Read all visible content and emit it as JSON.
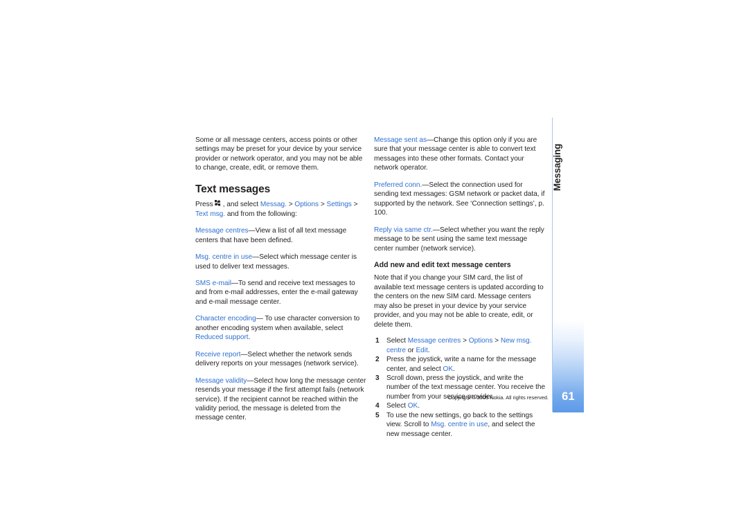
{
  "page": {
    "number": "61",
    "tab_label": "Messaging",
    "copyright": "Copyright © 2005 Nokia. All rights reserved.",
    "accent_blue": "#2f6fd0",
    "tab_gradient_end": "#5d9ae8",
    "divider_color": "#a9c8ea"
  },
  "left_column": {
    "intro_paragraph": "Some or all message centers, access points or other settings may be preset for your device by your service provider or network operator, and you may not be able to change, create, edit, or remove them.",
    "section_title": "Text messages",
    "press_line": {
      "prefix": "Press",
      "icon": "menu-key-icon",
      "middle": ", and select",
      "link1": "Messag.",
      "sep1": ">",
      "link2": "Options",
      "sep2": ">",
      "link3": "Settings",
      "sep3": ">",
      "link4": "Text msg.",
      "suffix": "and from the following:"
    },
    "settings": [
      {
        "term": "Message centres",
        "body": "—View a list of all text message centers that have been defined."
      },
      {
        "term": "Msg. centre in use",
        "body": "—Select which message center is used to deliver text messages."
      },
      {
        "term": "SMS e-mail",
        "body": "—To send and receive text messages to and from e-mail addresses, enter the e-mail gateway and e-mail message center."
      },
      {
        "term": "Character encoding",
        "body": "— To use character conversion to another encoding system when available, select ",
        "term2": "Reduced support",
        "body2": "."
      },
      {
        "term": "Receive report",
        "body": "—Select whether the network sends delivery reports on your messages (network service)."
      },
      {
        "term": "Message validity",
        "body": "—Select how long the message center resends your message if the first attempt fails (network service). If the recipient cannot be reached within the validity period, the message is deleted from the message center."
      }
    ]
  },
  "right_column": {
    "settings": [
      {
        "term": "Message sent as",
        "body": "—Change this option only if you are sure that your message center is able to convert text messages into these other formats. Contact your network operator."
      },
      {
        "term": "Preferred conn.",
        "body": "—Select the connection used for sending text messages: GSM network or packet data, if supported by the network. See ‘Connection settings’, p. 100."
      },
      {
        "term": "Reply via same ctr.",
        "body": "—Select whether you want the reply message to be sent using the same text message center number (network service)."
      }
    ],
    "sub_title": "Add new and edit text message centers",
    "note_paragraph": "Note that if you change your SIM card, the list of available text message centers is updated according to the centers on the new SIM card. Message centers may also be preset in your device by your service provider, and you may not be able to create, edit, or delete them.",
    "steps": [
      {
        "pre": "Select ",
        "link1": "Message centres",
        "mid1": " > ",
        "link2": "Options",
        "mid2": " > ",
        "link3": "New msg. centre",
        "mid3": " or ",
        "link4": "Edit",
        "post": "."
      },
      {
        "pre": "Press the joystick, write a name for the message center, and select ",
        "link1": "OK",
        "post": "."
      },
      {
        "pre": "Scroll down, press the joystick, and write the number of the text message center. You receive the number from your service provider.",
        "post": ""
      },
      {
        "pre": "Select ",
        "link1": "OK",
        "post": "."
      },
      {
        "pre": "To use the new settings, go back to the settings view. Scroll to ",
        "link1": "Msg. centre in use",
        "post": ", and select the new message center."
      }
    ]
  }
}
